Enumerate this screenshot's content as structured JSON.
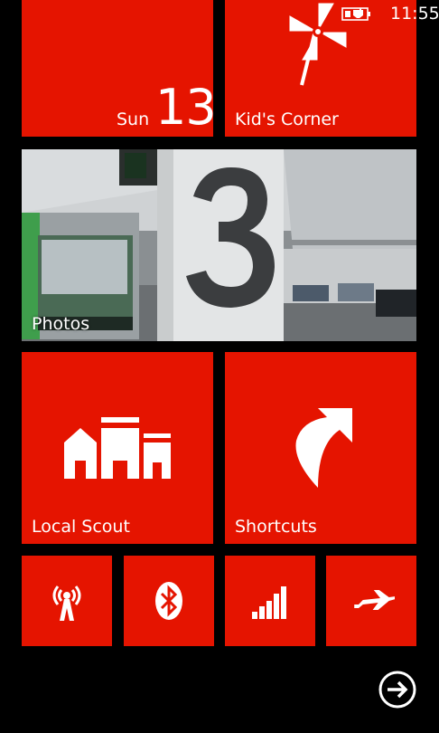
{
  "status_bar": {
    "time": "11:55",
    "battery_icon": "battery-charging-icon"
  },
  "colors": {
    "accent": "#e51400",
    "background": "#000000",
    "text": "#ffffff"
  },
  "tiles": {
    "date": {
      "day": "Sun",
      "number": "13"
    },
    "kids_corner": {
      "label": "Kid's Corner",
      "icon": "pinwheel-icon"
    },
    "photos": {
      "label": "Photos"
    },
    "local_scout": {
      "label": "Local Scout",
      "icon": "buildings-icon"
    },
    "shortcuts": {
      "label": "Shortcuts",
      "icon": "curved-arrow-icon"
    },
    "small": [
      {
        "name": "hotspot",
        "icon": "wifi-hotspot-icon"
      },
      {
        "name": "bluetooth",
        "icon": "bluetooth-icon"
      },
      {
        "name": "cellular",
        "icon": "cellular-signal-icon"
      },
      {
        "name": "airplane",
        "icon": "airplane-icon"
      }
    ]
  },
  "navigation": {
    "icon": "arrow-right-circle-icon"
  }
}
